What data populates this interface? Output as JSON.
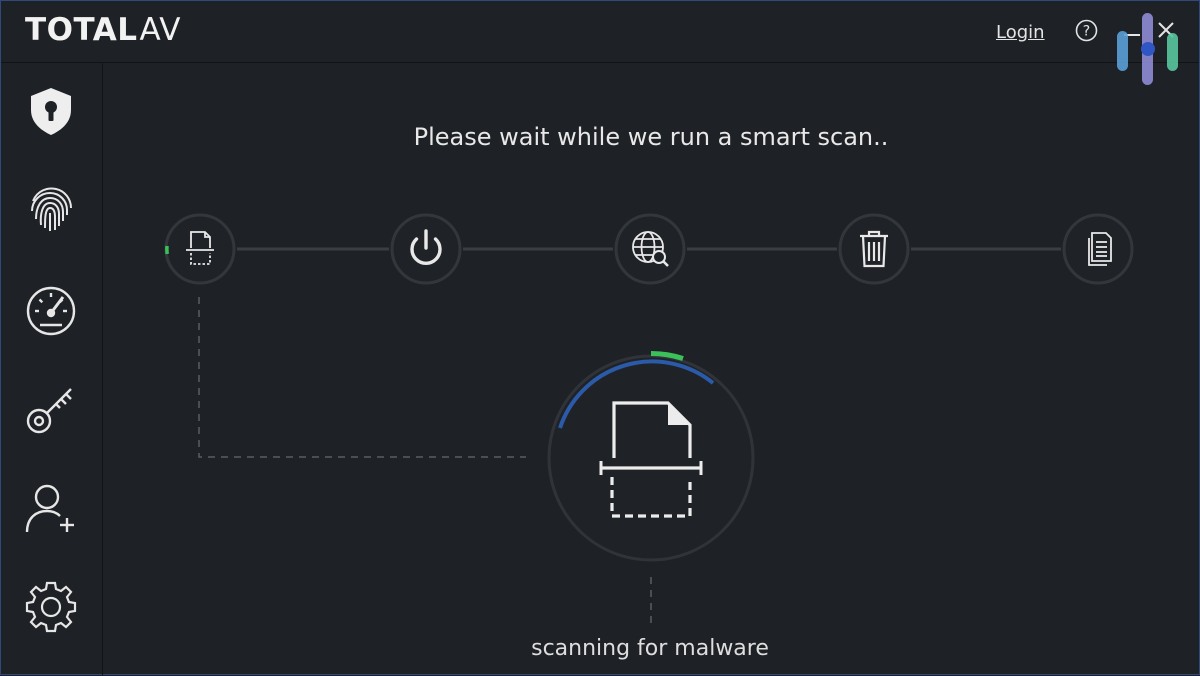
{
  "app": {
    "brand_bold": "TOTAL",
    "brand_light": "AV",
    "login_label": "Login",
    "help_glyph": "?"
  },
  "sidebar": {
    "items": [
      {
        "icon": "shield-icon",
        "label": "Protection"
      },
      {
        "icon": "fingerprint-icon",
        "label": "Privacy"
      },
      {
        "icon": "speedometer-icon",
        "label": "Performance"
      },
      {
        "icon": "key-icon",
        "label": "Password Vault"
      },
      {
        "icon": "add-user-icon",
        "label": "Account"
      },
      {
        "icon": "gear-icon",
        "label": "Settings"
      }
    ]
  },
  "main": {
    "headline": "Please wait while we run a smart scan..",
    "steps": [
      {
        "icon": "file-scan-icon",
        "state": "active"
      },
      {
        "icon": "power-icon",
        "state": "pending"
      },
      {
        "icon": "web-search-icon",
        "state": "pending"
      },
      {
        "icon": "trash-icon",
        "state": "pending"
      },
      {
        "icon": "documents-icon",
        "state": "pending"
      }
    ],
    "status_text": "scanning for malware"
  },
  "colors": {
    "background": "#1e2125",
    "step_ring": "#2f3338",
    "accent_green": "#3cc15a",
    "accent_blue": "#2b5aa8",
    "icon": "#e8e8e8"
  }
}
